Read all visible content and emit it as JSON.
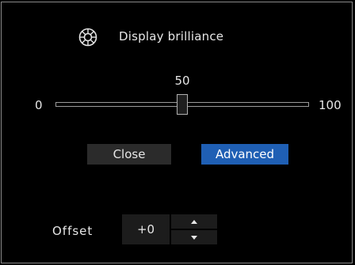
{
  "dialog": {
    "title": "Display brilliance",
    "icon": "brightness-icon"
  },
  "slider": {
    "min_label": "0",
    "max_label": "100",
    "value": 50,
    "value_label": "50",
    "min": 0,
    "max": 100
  },
  "buttons": {
    "close_label": "Close",
    "advanced_label": "Advanced"
  },
  "offset": {
    "label": "Offset",
    "value": "+0"
  },
  "colors": {
    "accent": "#1f5fb4",
    "background": "#000000",
    "button_bg": "#2b2b2b"
  }
}
